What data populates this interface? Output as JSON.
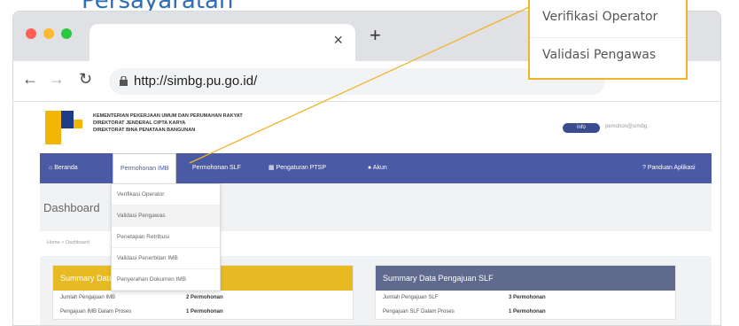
{
  "page_heading": "Persayaratan",
  "browser": {
    "tab_close": "×",
    "new_tab": "+",
    "url": "http://simbg.pu.go.id/"
  },
  "site": {
    "org_lines": [
      "KEMENTERIAN PEKERJAAN UMUM DAN PERUMAHAN RAKYAT",
      "DIREKTORAT JENDERAL CIPTA KARYA",
      "DIREKTORAT BINA PENATAAN BANGUNAN"
    ],
    "info_badge": "info",
    "user_label": "pemohon@simbg"
  },
  "nav": {
    "beranda": "Beranda",
    "permohonan_imb": "Permohonan IMB",
    "permohonan_slf": "Permohonan SLF",
    "pengaturan_ptsp": "Pengaturan PTSP",
    "akun": "Akun",
    "panduan": "Panduan Aplikasi"
  },
  "dropdown": {
    "items": [
      "Verifikasi Operator",
      "Validasi Pengawas",
      "Penetapan Retribusi",
      "Validasi Penerbitan IMB",
      "Penyerahan Dokumen IMB"
    ]
  },
  "dashboard": {
    "title": "Dashboard",
    "breadcrumb": "Home > Dashboard"
  },
  "panel_left": {
    "title": "Summary Data Pengajuan IMB",
    "rows": [
      {
        "k": "Jumlah Pengajuan IMB",
        "v": "2 Permohonan"
      },
      {
        "k": "Pengajuan IMB Dalam Proses",
        "v": "1 Permohonan"
      }
    ]
  },
  "panel_right": {
    "title": "Summary Data Pengajuan SLF",
    "rows": [
      {
        "k": "Jumlah Pengajuan SLF",
        "v": "3 Permohonan"
      },
      {
        "k": "Pengajuan SLF Dalam Proses",
        "v": "1 Permohonan"
      }
    ]
  },
  "callout": {
    "item1": "Verifikasi Operator",
    "item2": "Validasi Pengawas"
  },
  "colors": {
    "nav": "#4a5aa5",
    "panel_left": "#e7b923",
    "panel_right": "#5f6a8e",
    "callout_border": "#f0b429"
  }
}
